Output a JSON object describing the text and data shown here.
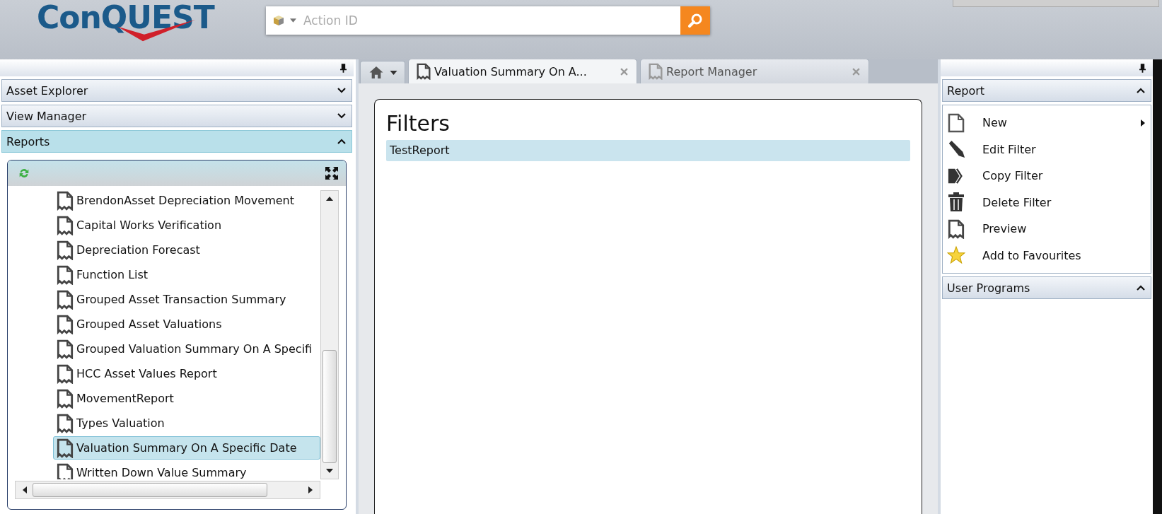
{
  "header": {
    "logo": "ConQUEST",
    "search": {
      "placeholder": "Action ID"
    }
  },
  "left_panel": {
    "sections": [
      {
        "title": "Asset Explorer",
        "expanded": false
      },
      {
        "title": "View Manager",
        "expanded": false
      },
      {
        "title": "Reports",
        "expanded": true
      }
    ],
    "report_tree": [
      {
        "label": "BrendonAsset Depreciation Movement",
        "selected": false
      },
      {
        "label": "Capital Works Verification",
        "selected": false
      },
      {
        "label": "Depreciation Forecast",
        "selected": false
      },
      {
        "label": "Function List",
        "selected": false
      },
      {
        "label": "Grouped Asset Transaction Summary",
        "selected": false
      },
      {
        "label": "Grouped Asset Valuations",
        "selected": false
      },
      {
        "label": "Grouped Valuation Summary On A Specifi",
        "selected": false
      },
      {
        "label": "HCC Asset Values Report",
        "selected": false
      },
      {
        "label": "MovementReport",
        "selected": false
      },
      {
        "label": "Types Valuation",
        "selected": false
      },
      {
        "label": "Valuation Summary On A Specific Date",
        "selected": true
      },
      {
        "label": "Written Down Value Summary",
        "selected": false
      }
    ]
  },
  "tabs": [
    {
      "label": "Valuation Summary On A...",
      "selected": true
    },
    {
      "label": "Report Manager",
      "selected": false
    }
  ],
  "content": {
    "title": "Filters",
    "filters": [
      {
        "label": "TestReport",
        "selected": true
      }
    ]
  },
  "right_panel": {
    "sections": [
      {
        "title": "Report",
        "expanded": true,
        "items": [
          {
            "label": "New",
            "has_submenu": true
          },
          {
            "label": "Edit Filter",
            "has_submenu": false
          },
          {
            "label": "Copy Filter",
            "has_submenu": false
          },
          {
            "label": "Delete Filter",
            "has_submenu": false
          },
          {
            "label": "Preview",
            "has_submenu": false
          },
          {
            "label": "Add to Favourites",
            "has_submenu": false
          }
        ]
      },
      {
        "title": "User Programs",
        "expanded": true
      }
    ]
  }
}
